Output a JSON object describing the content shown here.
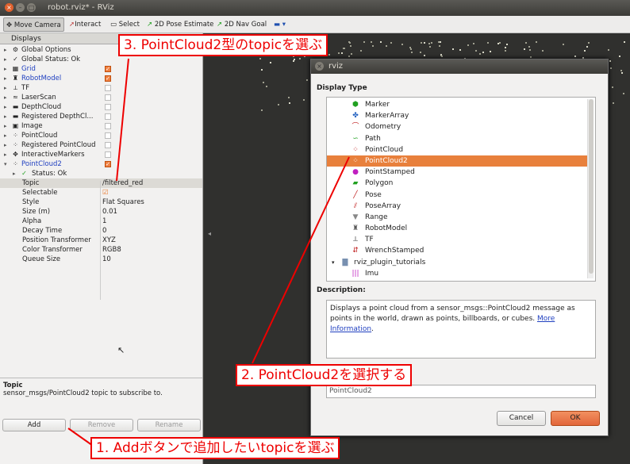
{
  "window": {
    "title": "robot.rviz* - RViz"
  },
  "toolbar": {
    "items": [
      {
        "label": "Move Camera",
        "icon": "move-camera-icon"
      },
      {
        "label": "Interact",
        "icon": "interact-icon"
      },
      {
        "label": "Select",
        "icon": "select-icon"
      },
      {
        "label": "2D Pose Estimate",
        "icon": "pose-estimate-icon"
      },
      {
        "label": "2D Nav Goal",
        "icon": "nav-goal-icon"
      }
    ]
  },
  "displays": {
    "header": "Displays",
    "items": [
      {
        "label": "Global Options",
        "checked": null,
        "icon": "gear-icon"
      },
      {
        "label": "Global Status: Ok",
        "checked": null,
        "icon": "check-icon"
      },
      {
        "label": "Grid",
        "checked": true,
        "icon": "grid-icon",
        "blue": true
      },
      {
        "label": "RobotModel",
        "checked": true,
        "icon": "robot-model-icon",
        "blue": true
      },
      {
        "label": "TF",
        "checked": false,
        "icon": "tf-icon"
      },
      {
        "label": "LaserScan",
        "checked": false,
        "icon": "laser-scan-icon"
      },
      {
        "label": "DepthCloud",
        "checked": false,
        "icon": "depth-cloud-icon"
      },
      {
        "label": "Registered DepthCl...",
        "checked": false,
        "icon": "depth-cloud-icon"
      },
      {
        "label": "Image",
        "checked": false,
        "icon": "image-icon"
      },
      {
        "label": "PointCloud",
        "checked": false,
        "icon": "point-cloud-icon"
      },
      {
        "label": "Registered PointCloud",
        "checked": false,
        "icon": "point-cloud-icon"
      },
      {
        "label": "InteractiveMarkers",
        "checked": false,
        "icon": "interactive-markers-icon"
      },
      {
        "label": "PointCloud2",
        "checked": true,
        "icon": "point-cloud2-icon",
        "blue": true
      }
    ],
    "status": "Status: Ok",
    "properties": [
      {
        "key": "Topic",
        "value": "/filtered_red"
      },
      {
        "key": "Selectable",
        "value": "☑"
      },
      {
        "key": "Style",
        "value": "Flat Squares"
      },
      {
        "key": "Size (m)",
        "value": "0.01"
      },
      {
        "key": "Alpha",
        "value": "1"
      },
      {
        "key": "Decay Time",
        "value": "0"
      },
      {
        "key": "Position Transformer",
        "value": "XYZ"
      },
      {
        "key": "Color Transformer",
        "value": "RGB8"
      },
      {
        "key": "Queue Size",
        "value": "10"
      }
    ],
    "help_title": "Topic",
    "help_text": "sensor_msgs/PointCloud2 topic to subscribe to.",
    "buttons": {
      "add": "Add",
      "remove": "Remove",
      "rename": "Rename"
    }
  },
  "dialog": {
    "title": "rviz",
    "display_type_label": "Display Type",
    "types": [
      {
        "label": "Marker",
        "icon": "marker-icon",
        "color": "#20a020"
      },
      {
        "label": "MarkerArray",
        "icon": "marker-array-icon",
        "color": "#2060c0"
      },
      {
        "label": "Odometry",
        "icon": "odometry-icon",
        "color": "#c02020"
      },
      {
        "label": "Path",
        "icon": "path-icon",
        "color": "#20a020"
      },
      {
        "label": "PointCloud",
        "icon": "point-cloud-icon",
        "color": "#c02020"
      },
      {
        "label": "PointCloud2",
        "icon": "point-cloud2-icon",
        "color": "#2060c0",
        "selected": true
      },
      {
        "label": "PointStamped",
        "icon": "point-stamped-icon",
        "color": "#c020c0"
      },
      {
        "label": "Polygon",
        "icon": "polygon-icon",
        "color": "#20a020"
      },
      {
        "label": "Pose",
        "icon": "pose-icon",
        "color": "#c02020"
      },
      {
        "label": "PoseArray",
        "icon": "pose-array-icon",
        "color": "#c02020"
      },
      {
        "label": "Range",
        "icon": "range-icon",
        "color": "#888888"
      },
      {
        "label": "RobotModel",
        "icon": "robot-model-icon",
        "color": "#555555"
      },
      {
        "label": "TF",
        "icon": "tf-icon",
        "color": "#333333"
      },
      {
        "label": "WrenchStamped",
        "icon": "wrench-icon",
        "color": "#c02020"
      }
    ],
    "group": {
      "label": "rviz_plugin_tutorials",
      "child": "Imu"
    },
    "description_label": "Description:",
    "description": "Displays a point cloud from a sensor_msgs::PointCloud2 message as points in the world, drawn as points, billboards, or cubes.",
    "description_link": "More Information",
    "name_value": "PointCloud2",
    "cancel": "Cancel",
    "ok": "OK"
  },
  "annotations": {
    "step1": "1. Addボタンで追加したいtopicを選ぶ",
    "step2": "2. PointCloud2を選択する",
    "step3": "3. PointCloud2型のtopicを選ぶ"
  },
  "colors": {
    "accent": "#e8803c",
    "annotation": "#ee0000",
    "link": "#2040c0"
  }
}
